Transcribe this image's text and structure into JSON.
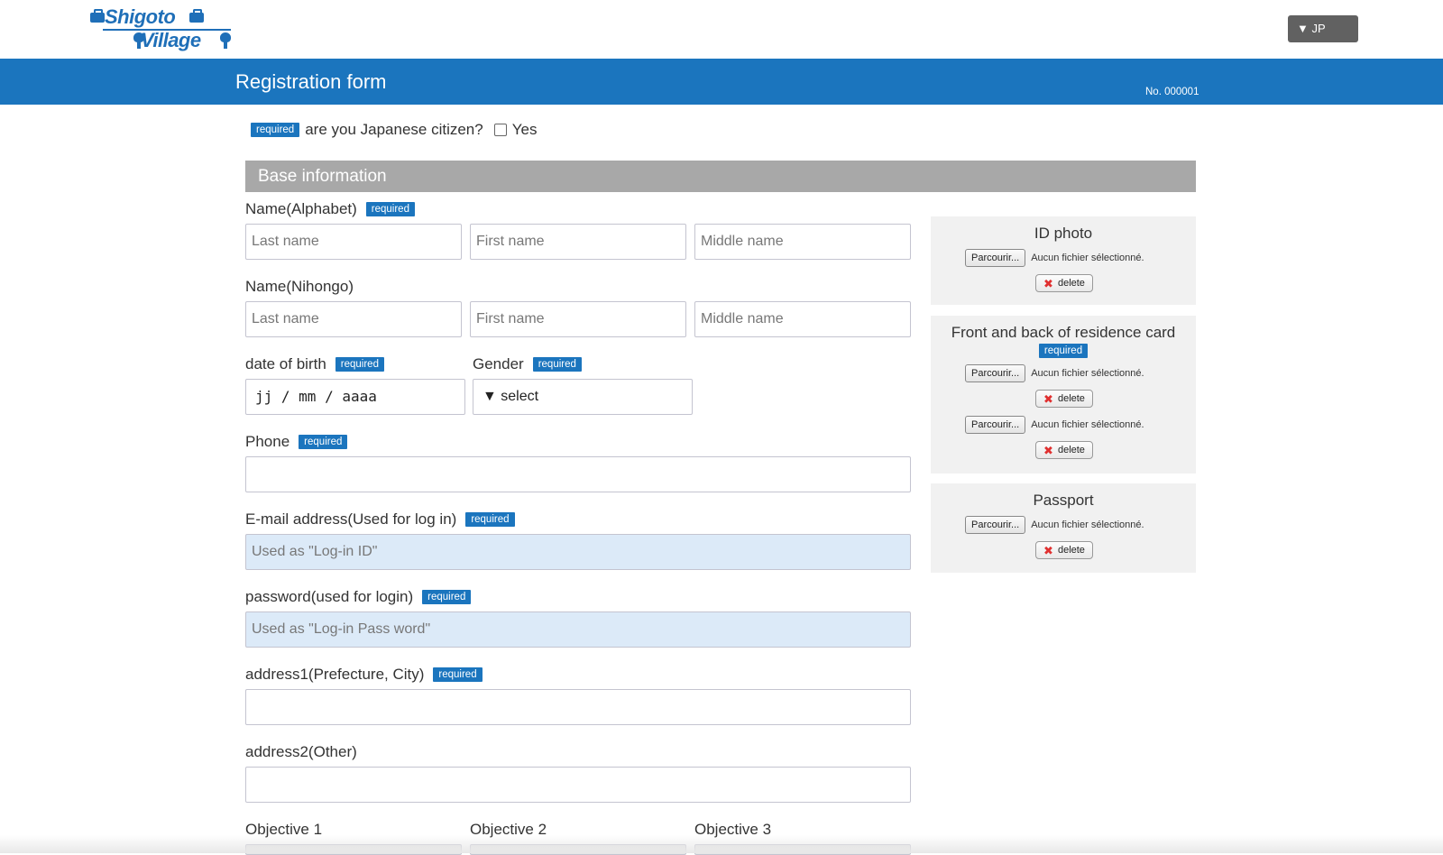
{
  "brand": {
    "logo_line1": "Shigoto",
    "logo_line2": "Village",
    "color": "#1f6fb8"
  },
  "language": {
    "label": "▼ JP"
  },
  "header": {
    "title": "Registration form",
    "number": "No. 000001",
    "color": "#1b75be"
  },
  "citizen": {
    "badge": "required",
    "question": "are you Japanese citizen?",
    "option": "Yes",
    "checked": false
  },
  "section": {
    "title": "Base information"
  },
  "form": {
    "name_alpha": {
      "label": "Name(Alphabet)",
      "badge": "required",
      "placeholders": [
        "Last name",
        "First name",
        "Middle name"
      ]
    },
    "name_nihongo": {
      "label": "Name(Nihongo)",
      "placeholders": [
        "Last name",
        "First name",
        "Middle name"
      ]
    },
    "dob": {
      "label": "date of birth",
      "badge": "required",
      "value": "jj / mm / aaaa"
    },
    "gender": {
      "label": "Gender",
      "badge": "required",
      "value": "▼ select"
    },
    "phone": {
      "label": "Phone",
      "badge": "required",
      "value": ""
    },
    "email": {
      "label": "E-mail address(Used for log in)",
      "badge": "required",
      "placeholder": "Used as \"Log-in ID\""
    },
    "password": {
      "label": "password(used for login)",
      "badge": "required",
      "placeholder": "Used as \"Log-in Pass word\""
    },
    "address1": {
      "label": "address1(Prefecture, City)",
      "badge": "required",
      "value": ""
    },
    "address2": {
      "label": "address2(Other)",
      "value": ""
    },
    "objectives": [
      "Objective 1",
      "Objective 2",
      "Objective 3"
    ]
  },
  "uploads": {
    "id_photo": {
      "title": "ID photo",
      "browse": "Parcourir...",
      "status": "Aucun fichier sélectionné.",
      "delete": "delete"
    },
    "residence": {
      "title": "Front and back of residence card",
      "badge": "required",
      "browse": "Parcourir...",
      "status": "Aucun fichier sélectionné.",
      "delete": "delete"
    },
    "passport": {
      "title": "Passport",
      "browse": "Parcourir...",
      "status": "Aucun fichier sélectionné.",
      "delete": "delete"
    }
  }
}
